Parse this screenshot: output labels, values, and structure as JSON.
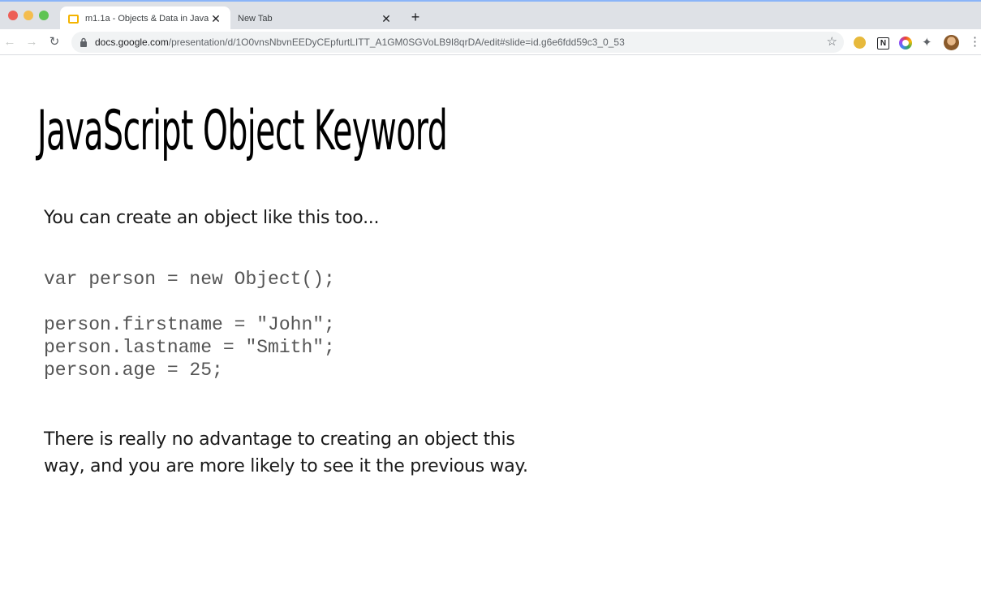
{
  "browser": {
    "tabs": [
      {
        "title": "m1.1a - Objects & Data in Java",
        "active": true
      },
      {
        "title": "New Tab",
        "active": false
      }
    ],
    "tab_close_glyph": "✕",
    "new_tab_glyph": "+",
    "url_host": "docs.google.com",
    "url_path": "/presentation/d/1O0vnsNbvnEEDyCEpfurtLITT_A1GM0SGVoLB9I8qrDA/edit#slide=id.g6e6fdd59c3_0_53",
    "extensions": [
      "yellow-circle-extension",
      "notion-extension",
      "color-picker-extension",
      "extensions-puzzle"
    ],
    "notion_letter": "N",
    "icons": {
      "back": "←",
      "forward": "→",
      "reload": "↻",
      "star": "☆",
      "puzzle": "✦",
      "more": "⋮"
    }
  },
  "slide": {
    "title": "JavaScript Object Keyword",
    "intro": "You can create an object like this too...",
    "code": [
      "var person = new Object();",
      "person.firstname = \"John\";",
      "person.lastname = \"Smith\";",
      "person.age = 25;"
    ],
    "outro_lines": [
      "There is really no advantage to creating an object this",
      "way, and you are more likely to see it the previous way."
    ]
  }
}
